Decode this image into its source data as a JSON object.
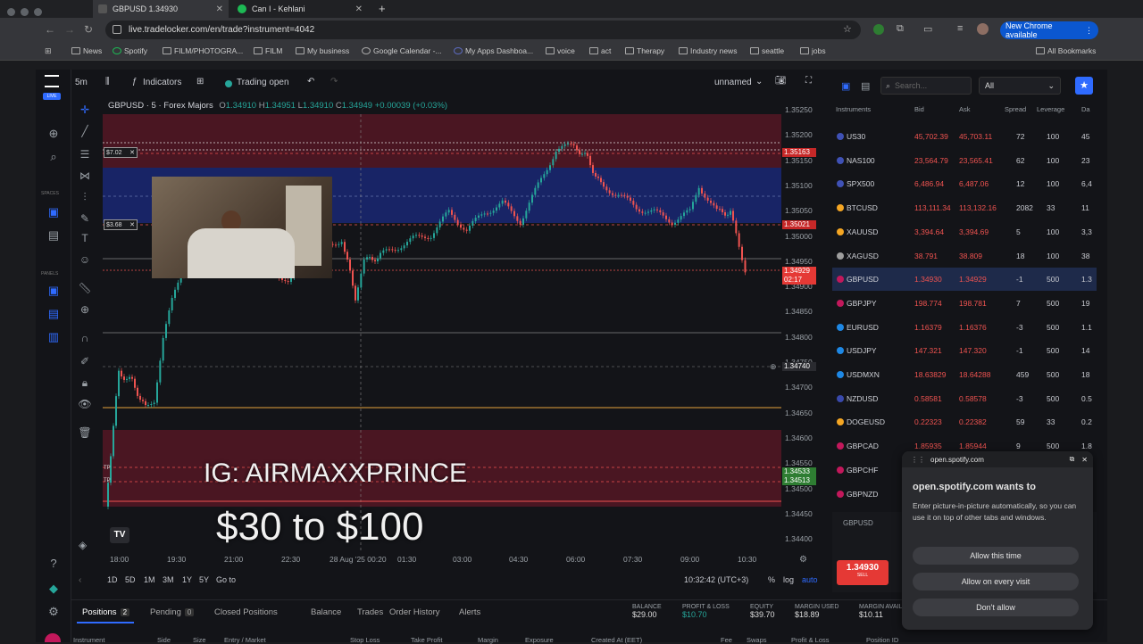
{
  "browser": {
    "tabs": [
      {
        "label": "GBPUSD 1.34930"
      },
      {
        "label": "Can I - Kehlani"
      }
    ],
    "url": "live.tradelocker.com/en/trade?instrument=4042",
    "new_chrome": "New Chrome available",
    "bookmarks": [
      "News",
      "Spotify",
      "FILM/PHOTOGRA...",
      "FILM",
      "My business",
      "Google Calendar -...",
      "My Apps Dashboa...",
      "voice",
      "act",
      "Therapy",
      "Industry news",
      "seattle",
      "jobs"
    ],
    "all_bookmarks": "All Bookmarks"
  },
  "app": {
    "live_badge": "LIVE",
    "left_labels": {
      "spaces": "SPACES",
      "panels": "PANELS"
    },
    "timeframe": "5m",
    "indicators": "Indicators",
    "trading_open": "Trading open",
    "layout_name": "unnamed",
    "symbol_title": "GBPUSD · 5 · Forex Majors",
    "ohlc": {
      "o": "O",
      "o_val": "1.34910",
      "h": "H",
      "h_val": "1.34951",
      "l": "L",
      "l_val": "1.34910",
      "c": "C",
      "c_val": "1.34949",
      "chg": "+0.00039 (+0.03%)"
    },
    "position_tags": [
      {
        "label": "$7.02"
      },
      {
        "label": "$3.68"
      }
    ],
    "tp_labels": [
      "TP",
      "TP"
    ],
    "price_labels": [
      "1.35250",
      "1.35200",
      "1.35150",
      "1.35100",
      "1.35050",
      "1.35000",
      "1.34950",
      "1.34900",
      "1.34850",
      "1.34800",
      "1.34750",
      "1.34700",
      "1.34650",
      "1.34600",
      "1.34550",
      "1.34500",
      "1.34450",
      "1.34400"
    ],
    "price_tags": {
      "upper": "1.35163",
      "entry2": "1.35021",
      "current": "1.34929",
      "countdown": "02:17",
      "cursor": "1.34740",
      "tp1": "1.34533",
      "tp2": "1.34513"
    },
    "time_labels": [
      "18:00",
      "19:30",
      "21:00",
      "22:30",
      "28 Aug '25  00:20",
      "01:30",
      "03:00",
      "04:30",
      "06:00",
      "07:30",
      "09:00",
      "10:30"
    ],
    "ranges": [
      "1D",
      "5D",
      "1M",
      "3M",
      "1Y",
      "5Y",
      "Go to"
    ],
    "clock": "10:32:42 (UTC+3)",
    "axis_opts": [
      "%",
      "log",
      "auto"
    ],
    "overlay": {
      "ig": "IG: AIRMAXXPRINCE",
      "goal": "$30 to $100"
    }
  },
  "instruments": {
    "search_placeholder": "Search...",
    "filter": "All",
    "headers": [
      "Instruments",
      "Bid",
      "Ask",
      "Spread",
      "Leverage",
      "Da"
    ],
    "rows": [
      {
        "sym": "US30",
        "bid": "45,702.39",
        "ask": "45,703.11",
        "spread": "72",
        "lev": "100",
        "d": "45"
      },
      {
        "sym": "NAS100",
        "bid": "23,564.79",
        "ask": "23,565.41",
        "spread": "62",
        "lev": "100",
        "d": "23"
      },
      {
        "sym": "SPX500",
        "bid": "6,486.94",
        "ask": "6,487.06",
        "spread": "12",
        "lev": "100",
        "d": "6,4"
      },
      {
        "sym": "BTCUSD",
        "bid": "113,111.34",
        "ask": "113,132.16",
        "spread": "2082",
        "lev": "33",
        "d": "11"
      },
      {
        "sym": "XAUUSD",
        "bid": "3,394.64",
        "ask": "3,394.69",
        "spread": "5",
        "lev": "100",
        "d": "3,3"
      },
      {
        "sym": "XAGUSD",
        "bid": "38.791",
        "ask": "38.809",
        "spread": "18",
        "lev": "100",
        "d": "38"
      },
      {
        "sym": "GBPUSD",
        "bid": "1.34930",
        "ask": "1.34929",
        "spread": "-1",
        "lev": "500",
        "d": "1.3"
      },
      {
        "sym": "GBPJPY",
        "bid": "198.774",
        "ask": "198.781",
        "spread": "7",
        "lev": "500",
        "d": "19"
      },
      {
        "sym": "EURUSD",
        "bid": "1.16379",
        "ask": "1.16376",
        "spread": "-3",
        "lev": "500",
        "d": "1.1"
      },
      {
        "sym": "USDJPY",
        "bid": "147.321",
        "ask": "147.320",
        "spread": "-1",
        "lev": "500",
        "d": "14"
      },
      {
        "sym": "USDMXN",
        "bid": "18.63829",
        "ask": "18.64288",
        "spread": "459",
        "lev": "500",
        "d": "18"
      },
      {
        "sym": "NZDUSD",
        "bid": "0.58581",
        "ask": "0.58578",
        "spread": "-3",
        "lev": "500",
        "d": "0.5"
      },
      {
        "sym": "DOGEUSD",
        "bid": "0.22323",
        "ask": "0.22382",
        "spread": "59",
        "lev": "33",
        "d": "0.2"
      },
      {
        "sym": "GBPCAD",
        "bid": "1.85935",
        "ask": "1.85944",
        "spread": "9",
        "lev": "500",
        "d": "1.8"
      },
      {
        "sym": "GBPCHF",
        "bid": "",
        "ask": "",
        "spread": "",
        "lev": "",
        "d": ""
      },
      {
        "sym": "GBPNZD",
        "bid": "",
        "ask": "",
        "spread": "",
        "lev": "",
        "d": ""
      }
    ],
    "order_symbol": "GBPUSD",
    "sell_price": "1.34930",
    "sell_label": "SELL"
  },
  "bottom": {
    "tabs": [
      {
        "label": "Positions",
        "count": "2"
      },
      {
        "label": "Pending",
        "count": "0"
      },
      {
        "label": "Closed Positions"
      },
      {
        "label": "Balance"
      },
      {
        "label": "Trades"
      },
      {
        "label": "Order History"
      },
      {
        "label": "Alerts"
      }
    ],
    "stats": [
      {
        "label": "BALANCE",
        "value": "$29.00"
      },
      {
        "label": "PROFIT & LOSS",
        "value": "$10.70"
      },
      {
        "label": "EQUITY",
        "value": "$39.70"
      },
      {
        "label": "MARGIN USED",
        "value": "$18.89"
      },
      {
        "label": "MARGIN AVAIL",
        "value": "$10.11"
      }
    ],
    "columns": [
      "Instrument",
      "Side",
      "Size",
      "Entry / Market",
      "Stop Loss",
      "Take Profit",
      "Margin",
      "Exposure",
      "Created At (EET)",
      "Fee",
      "Swaps",
      "Profit & Loss",
      "Position ID"
    ]
  },
  "popup": {
    "host": "open.spotify.com",
    "title": "open.spotify.com wants to",
    "body": "Enter picture-in-picture automatically, so you can use it on top of other tabs and windows.",
    "buttons": [
      "Allow this time",
      "Allow on every visit",
      "Don't allow"
    ]
  },
  "colors": {
    "accent": "#2f6bff",
    "up": "#26a69a",
    "down": "#ef5350",
    "red_zone": "#5b1a26",
    "blue_zone": "#1a2660"
  }
}
